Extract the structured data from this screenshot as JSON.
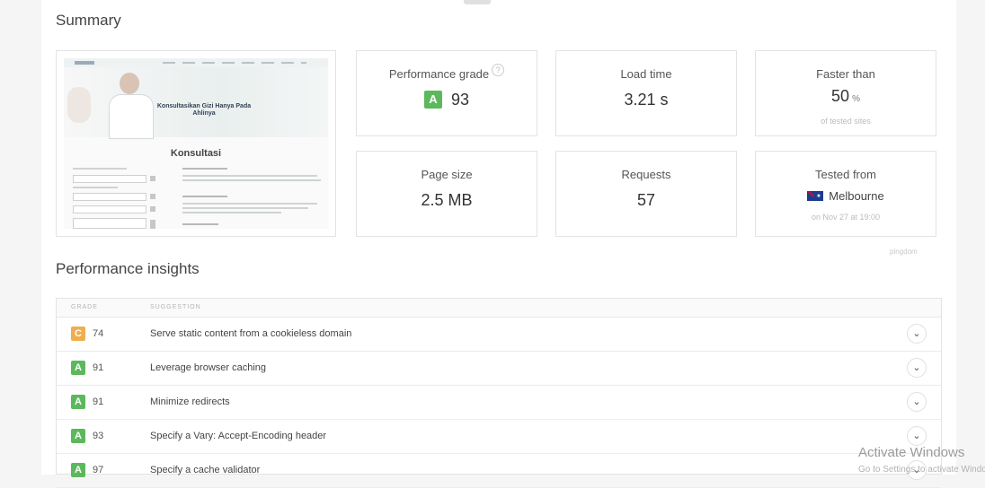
{
  "summary": {
    "title": "Summary",
    "screenshot": {
      "hero_text": "Konsultasikan Gizi Hanya Pada Ahlinya",
      "heading": "Konsultasi"
    },
    "metrics": {
      "performance_grade": {
        "label": "Performance grade",
        "grade": "A",
        "score": "93",
        "grade_color": "#5cb85c"
      },
      "load_time": {
        "label": "Load time",
        "value": "3.21 s"
      },
      "faster_than": {
        "label": "Faster than",
        "value": "50",
        "unit": "%",
        "sub": "of tested sites"
      },
      "page_size": {
        "label": "Page size",
        "value": "2.5 MB"
      },
      "requests": {
        "label": "Requests",
        "value": "57"
      },
      "tested_from": {
        "label": "Tested from",
        "location": "Melbourne",
        "flag_icon": "australia-flag-icon",
        "sub": "on Nov 27 at 19:00"
      }
    },
    "credit": "pingdom"
  },
  "insights": {
    "title": "Performance insights",
    "columns": {
      "grade": "GRADE",
      "suggestion": "SUGGESTION"
    },
    "rows": [
      {
        "grade": "C",
        "score": "74",
        "suggestion": "Serve static content from a cookieless domain",
        "color": "#f0ad4e"
      },
      {
        "grade": "A",
        "score": "91",
        "suggestion": "Leverage browser caching",
        "color": "#5cb85c"
      },
      {
        "grade": "A",
        "score": "91",
        "suggestion": "Minimize redirects",
        "color": "#5cb85c"
      },
      {
        "grade": "A",
        "score": "93",
        "suggestion": "Specify a Vary: Accept-Encoding header",
        "color": "#5cb85c"
      },
      {
        "grade": "A",
        "score": "97",
        "suggestion": "Specify a cache validator",
        "color": "#5cb85c"
      }
    ],
    "expand_icon": "chevron-down-icon"
  },
  "watermark": {
    "title": "Activate Windows",
    "sub": "Go to Settings to activate Windows."
  }
}
